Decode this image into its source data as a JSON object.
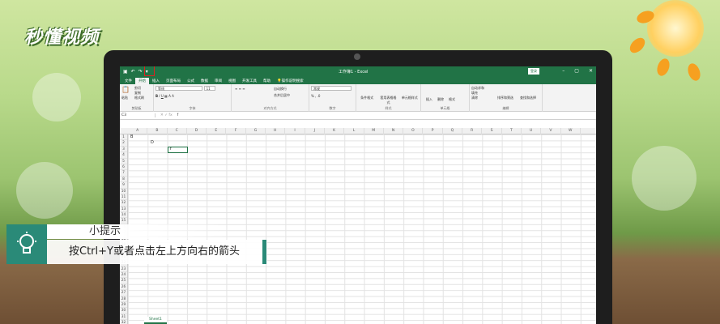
{
  "watermark": {
    "logo": "秒懂视频"
  },
  "excel": {
    "title": "工作簿1 - Excel",
    "signin": "登录",
    "tabs": [
      "文件",
      "开始",
      "插入",
      "页面布局",
      "公式",
      "数据",
      "审阅",
      "视图",
      "开发工具",
      "帮助",
      "操作说明搜索"
    ],
    "ribbon": {
      "paste": "粘贴",
      "cut": "剪切",
      "copy": "复制",
      "format_painter": "格式刷",
      "font_name": "等线",
      "font_size": "11",
      "wrap": "自动换行",
      "merge": "合并后居中",
      "number_format": "常规",
      "cond_format": "条件格式",
      "table_format": "套用表格格式",
      "cell_style": "单元格样式",
      "insert": "插入",
      "delete": "删除",
      "format": "格式",
      "autosum": "自动求和",
      "fill": "填充",
      "clear": "清除",
      "sort": "排序和筛选",
      "find": "查找和选择",
      "groups": [
        "剪贴板",
        "字体",
        "对齐方式",
        "数字",
        "样式",
        "单元格",
        "编辑"
      ]
    },
    "name_box": "C3",
    "formula": "f",
    "columns": [
      "A",
      "B",
      "C",
      "D",
      "E",
      "F",
      "G",
      "H",
      "I",
      "J",
      "K",
      "L",
      "M",
      "N",
      "O",
      "P",
      "Q",
      "R",
      "S",
      "T",
      "U",
      "V",
      "W"
    ],
    "rows": [
      "1",
      "2",
      "3",
      "4",
      "5",
      "6",
      "7",
      "8",
      "9",
      "10",
      "11",
      "12",
      "13",
      "14",
      "15",
      "16",
      "17",
      "18",
      "19",
      "20",
      "21",
      "22",
      "23",
      "24",
      "25",
      "26",
      "27",
      "28",
      "29",
      "30",
      "31",
      "32"
    ],
    "cells": {
      "a1": "B",
      "b2": "D",
      "c3": "f"
    },
    "sheet": "Sheet1"
  },
  "tip": {
    "heading": "小提示",
    "body": "按Ctrl+Y或者点击左上方向右的箭头"
  }
}
